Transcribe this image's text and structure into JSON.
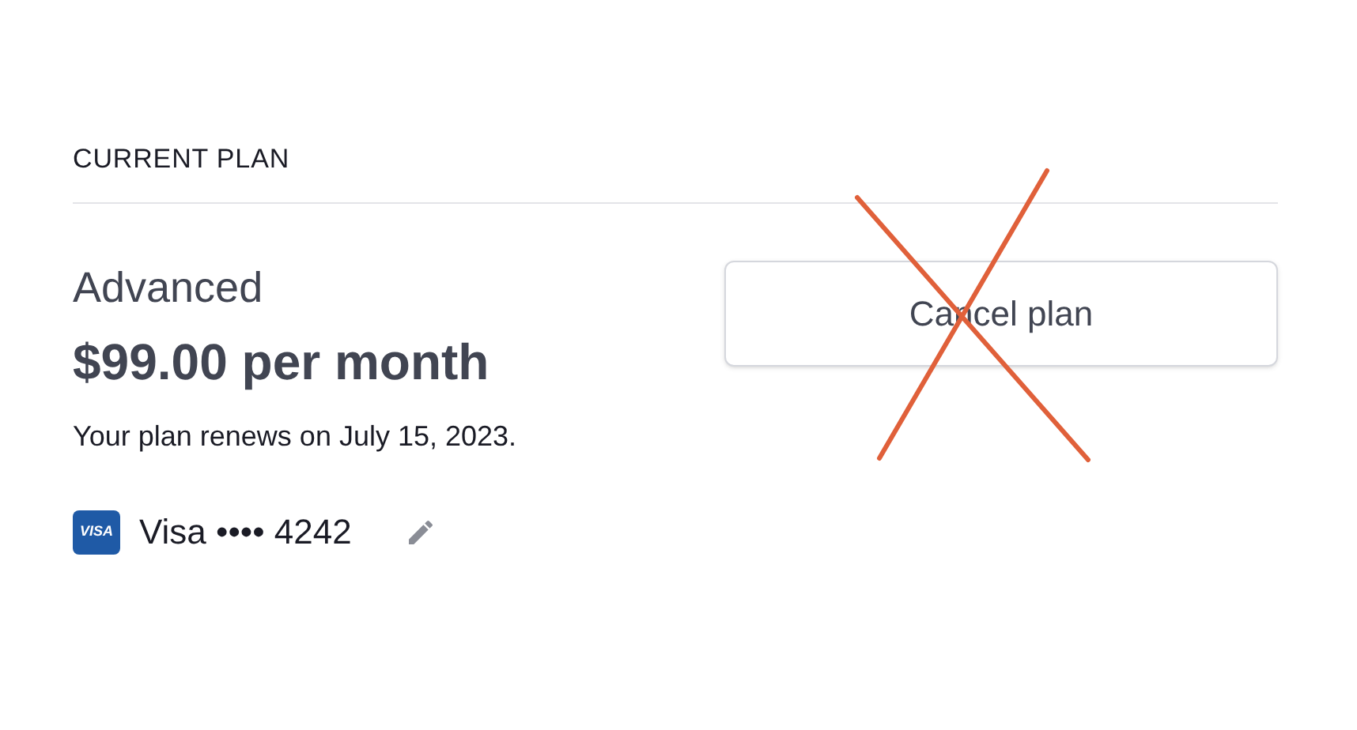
{
  "section_title": "CURRENT PLAN",
  "plan": {
    "name": "Advanced",
    "price": "$99.00 per month",
    "renewal": "Your plan renews on July 15, 2023."
  },
  "payment_method": {
    "brand_mark": "VISA",
    "label": "Visa •••• 4242"
  },
  "cancel_button": {
    "label": "Cancel plan",
    "crossed_out": true
  }
}
